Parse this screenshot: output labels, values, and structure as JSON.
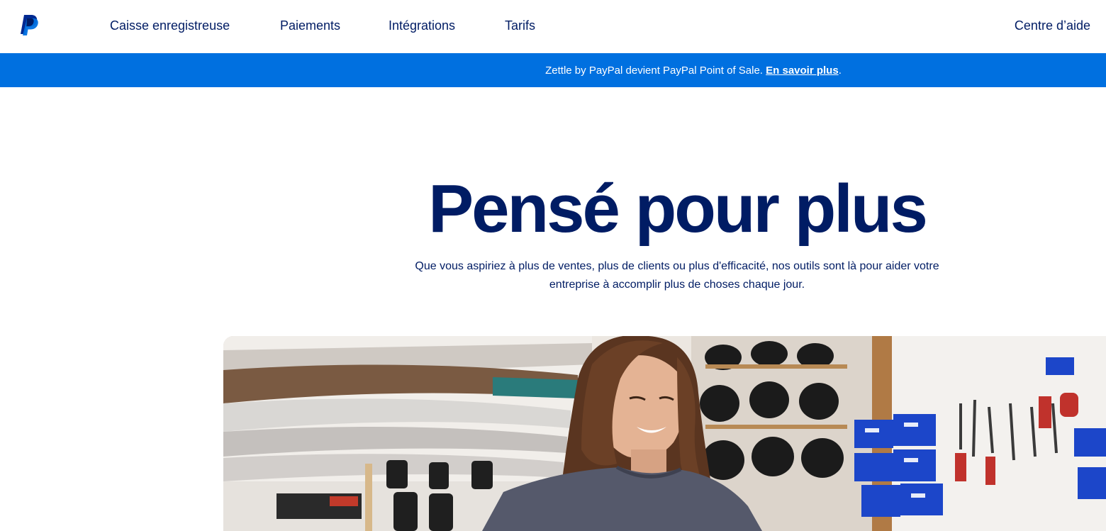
{
  "header": {
    "logo_icon": "paypal-logo-icon",
    "nav": [
      {
        "label": "Caisse enregistreuse"
      },
      {
        "label": "Paiements"
      },
      {
        "label": "Intégrations"
      },
      {
        "label": "Tarifs"
      }
    ],
    "help_label": "Centre d’aide"
  },
  "banner": {
    "text": "Zettle by PayPal devient PayPal Point of Sale.",
    "link_label": "En savoir plus",
    "trailing": ".",
    "color": "#0070e0"
  },
  "hero": {
    "title": "Pensé pour plus",
    "subtitle_line1": "Que vous aspiriez à plus de ventes, plus de clients ou plus d'efficacité, nos outils sont là pour aider votre",
    "subtitle_line2": "entreprise à accomplir plus de choses chaque jour.",
    "image_subject": "smiling shop owner in a snowboard and ski repair workshop"
  },
  "colors": {
    "navy": "#001c64",
    "brand_blue": "#0070e0",
    "logo_light": "#009cde"
  }
}
